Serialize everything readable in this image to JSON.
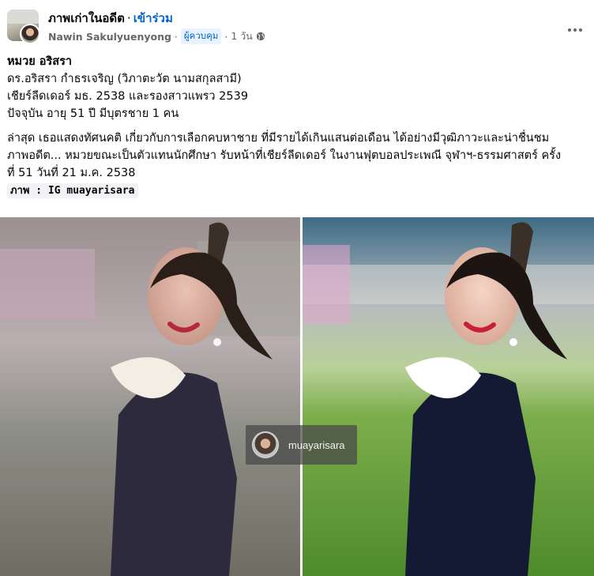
{
  "header": {
    "group_name": "ภาพเก่าในอดีต",
    "separator": "·",
    "join_label": "เข้าร่วม",
    "author": "Nawin Sakulyuenyong",
    "meta_separator": "·",
    "role_badge": "ผู้ควบคุม",
    "time": "1 วัน",
    "privacy_icon": "globe-icon",
    "more_icon": "more-options-icon"
  },
  "post": {
    "line1": "หมวย อริสรา",
    "line2": "ดร.อริสรา กำธรเจริญ (วิภาตะวัต นามสกุลสามี)",
    "line3": "เชียร์ลีดเดอร์ มธ. 2538 และรองสาวแพรว 2539",
    "line4": "ปัจจุบัน อายุ 51 ปี มีบุตรชาย 1 คน",
    "para1": "ล่าสุด เธอแสดงทัศนคติ เกี่ยวกับการเลือกคบหาชาย ที่มีรายได้เกินแสนต่อเดือน ได้อย่างมีวุฒิภาวะและน่าชื่นชม",
    "para2": "ภาพอดีต... หมวยขณะเป็นตัวแทนนักศึกษา รับหน้าที่เชียร์ลีดเดอร์ ในงานฟุตบอลประเพณี จุฬาฯ-ธรรมศาสตร์ ครั้ง",
    "para3": "ที่ 51 วันที่ 21 ม.ค. 2538",
    "credit": "ภาพ : IG muayarisara"
  },
  "photos": {
    "watermark_text": "muayarisara"
  },
  "colors": {
    "link": "#0064d1",
    "secondary_text": "#65676b",
    "badge_bg": "#e7f3ff"
  }
}
